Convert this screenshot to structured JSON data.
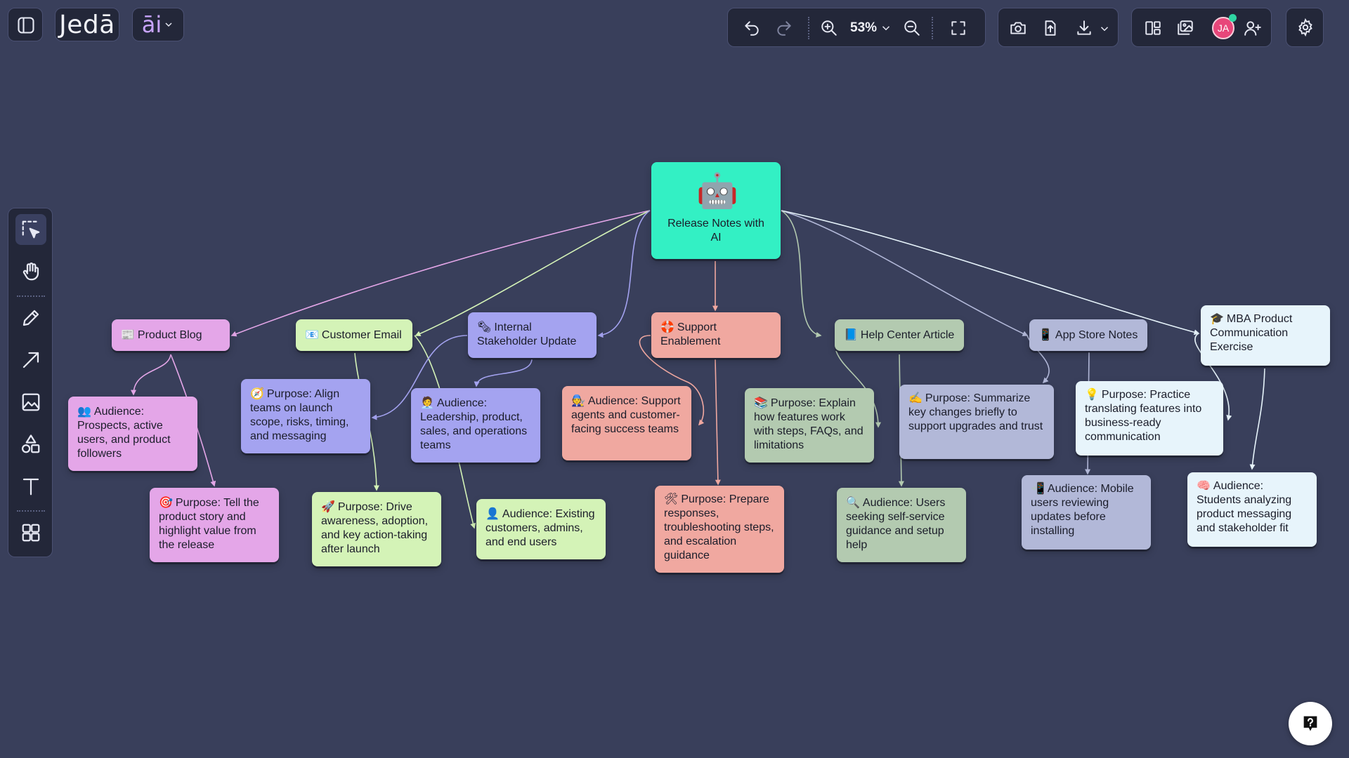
{
  "app": {
    "logo_text": "Jedā",
    "ai_label": "āi"
  },
  "toolbar": {
    "zoom_level": "53%",
    "avatar_initials": "JA"
  },
  "colors": {
    "background": "#393f5b",
    "root": "#33f0c4",
    "pink": "#e4a6e8",
    "green": "#d4f3b7",
    "purple": "#a4a3f0",
    "salmon": "#f0a8a0",
    "sage": "#b3cab0",
    "slate": "#b2b8d8",
    "ice": "#e7f4fb",
    "avatar": "#e8467a"
  },
  "diagram": {
    "root": {
      "icon": "🤖",
      "label": "Release Notes with AI"
    },
    "nodes": [
      {
        "id": "product-blog",
        "icon": "📰",
        "label": "Product Blog"
      },
      {
        "id": "blog-audience",
        "icon": "👥",
        "label": "Audience: Prospects, active users, and product followers"
      },
      {
        "id": "blog-purpose",
        "icon": "🎯",
        "label": "Purpose: Tell the product story and highlight value from the release"
      },
      {
        "id": "customer-email",
        "icon": "📧",
        "label": "Customer Email"
      },
      {
        "id": "email-purpose",
        "icon": "🚀",
        "label": "Purpose: Drive awareness, adoption, and key action-taking after launch"
      },
      {
        "id": "email-audience",
        "icon": "👤",
        "label": "Audience: Existing customers, admins, and end users"
      },
      {
        "id": "internal-update",
        "icon": "🗞",
        "label": "Internal Stakeholder Update"
      },
      {
        "id": "internal-purpose",
        "icon": "🧭",
        "label": "Purpose: Align teams on launch scope, risks, timing, and messaging"
      },
      {
        "id": "internal-audience",
        "icon": "🧑‍💼",
        "label": "Audience: Leadership, product, sales, and operations teams"
      },
      {
        "id": "support",
        "icon": "🛟",
        "label": "Support Enablement"
      },
      {
        "id": "support-audience",
        "icon": "🧑‍🔧",
        "label": "Audience: Support agents and customer-facing success teams"
      },
      {
        "id": "support-purpose",
        "icon": "🛠",
        "label": "Purpose: Prepare responses, troubleshooting steps, and escalation guidance"
      },
      {
        "id": "help-center",
        "icon": "📘",
        "label": "Help Center Article"
      },
      {
        "id": "help-purpose",
        "icon": "📚",
        "label": "Purpose: Explain how features work with steps, FAQs, and limitations"
      },
      {
        "id": "help-audience",
        "icon": "🔍",
        "label": "Audience: Users seeking self-service guidance and setup help"
      },
      {
        "id": "app-store",
        "icon": "📱",
        "label": "App Store Notes"
      },
      {
        "id": "app-purpose",
        "icon": "✍️",
        "label": "Purpose: Summarize key changes briefly to support upgrades and trust"
      },
      {
        "id": "app-audience",
        "icon": "📲",
        "label": "Audience: Mobile users reviewing updates before installing"
      },
      {
        "id": "mba",
        "icon": "🎓",
        "label": "MBA Product Communication Exercise"
      },
      {
        "id": "mba-purpose",
        "icon": "💡",
        "label": "Purpose: Practice translating features into business-ready communication"
      },
      {
        "id": "mba-audience",
        "icon": "🧠",
        "label": "Audience: Students analyzing product messaging and stakeholder fit"
      }
    ]
  }
}
